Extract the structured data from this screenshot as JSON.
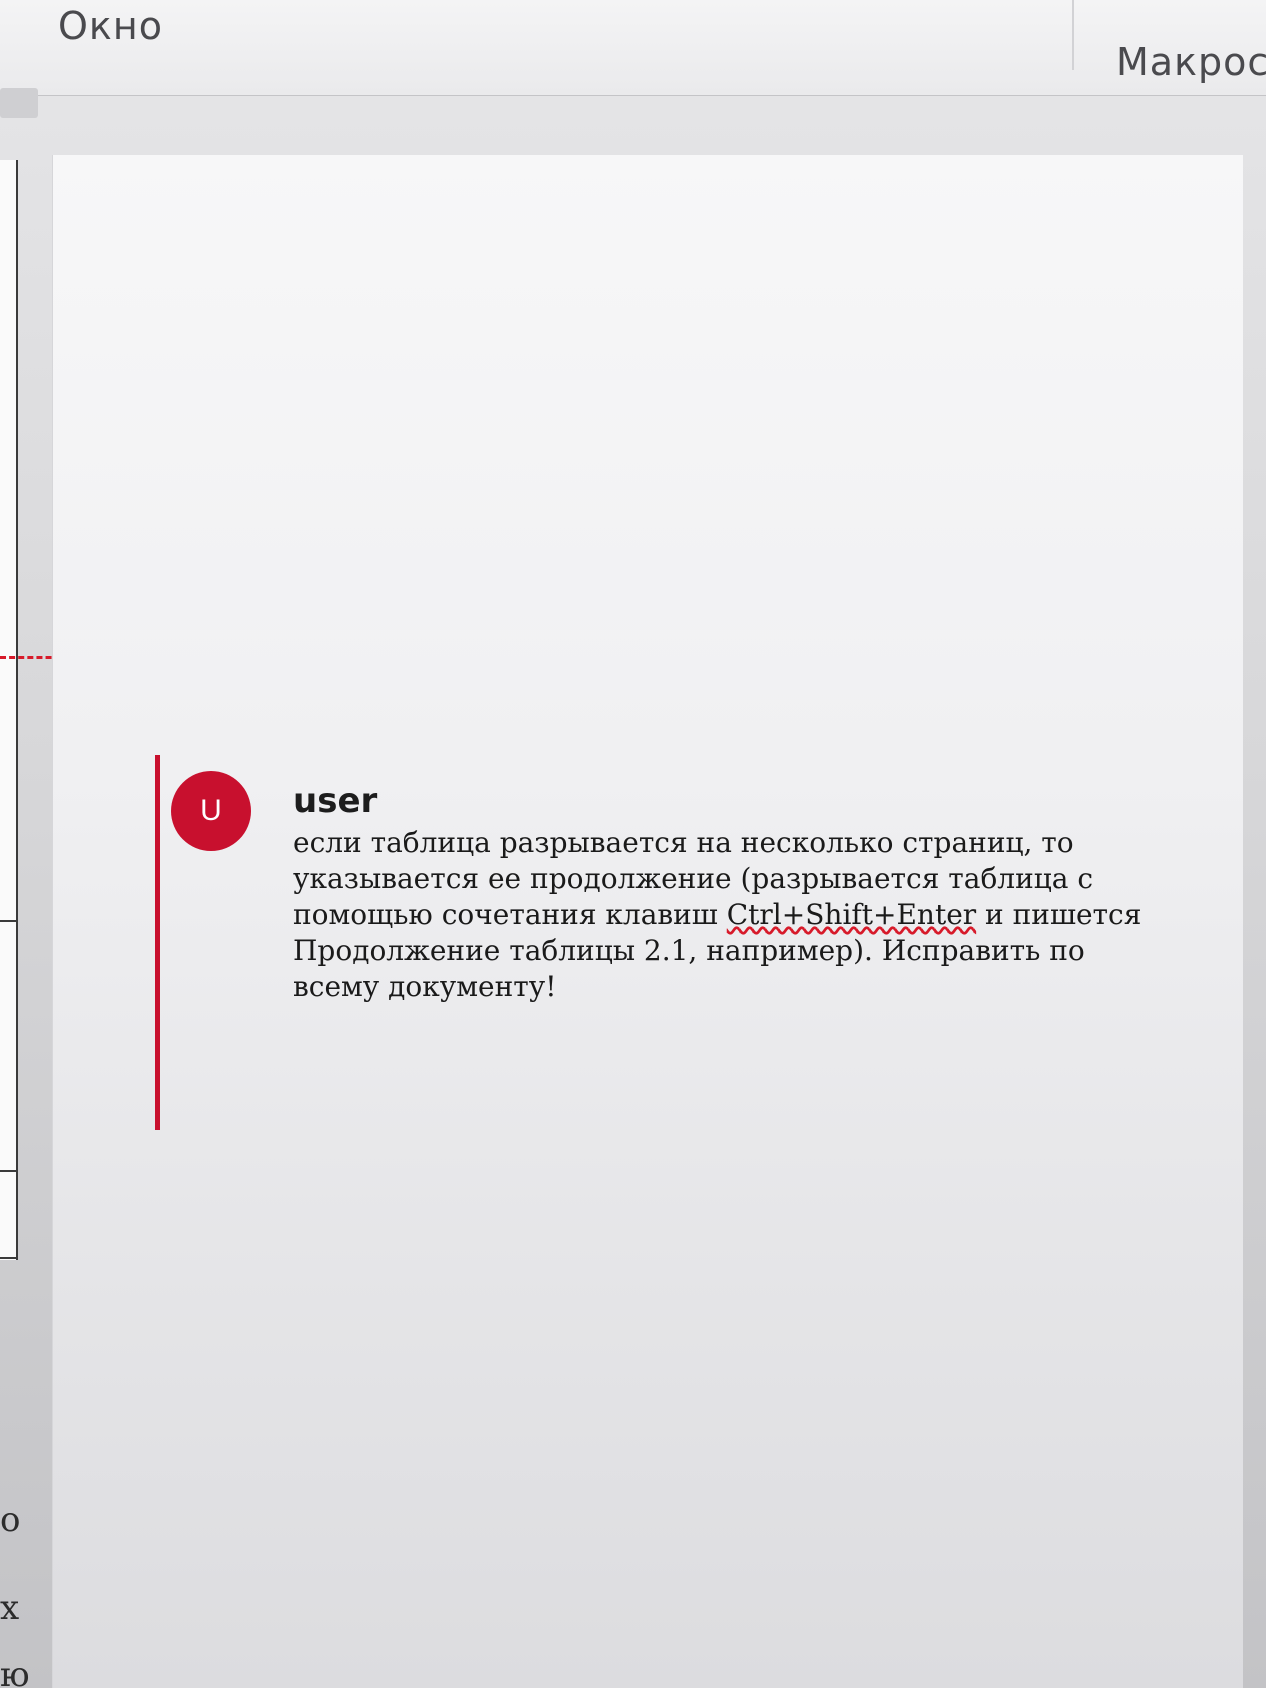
{
  "ribbon": {
    "tab_window": "Окно",
    "tab_macros": "Макрос"
  },
  "left_margin": {
    "chars": [
      "о",
      "х",
      "ю"
    ]
  },
  "comment": {
    "avatar_initial": "U",
    "author": "user",
    "text_before": "если таблица разрывается на несколько страниц, то указывается ее продолжение (разрывается таблица с помощью сочетания клавиш ",
    "hotkey": "Ctrl+Shift+Enter",
    "text_after": " и пишется Продолжение таблицы 2.1, например). Исправить по всему документу!",
    "accent_color": "#c8102e"
  }
}
